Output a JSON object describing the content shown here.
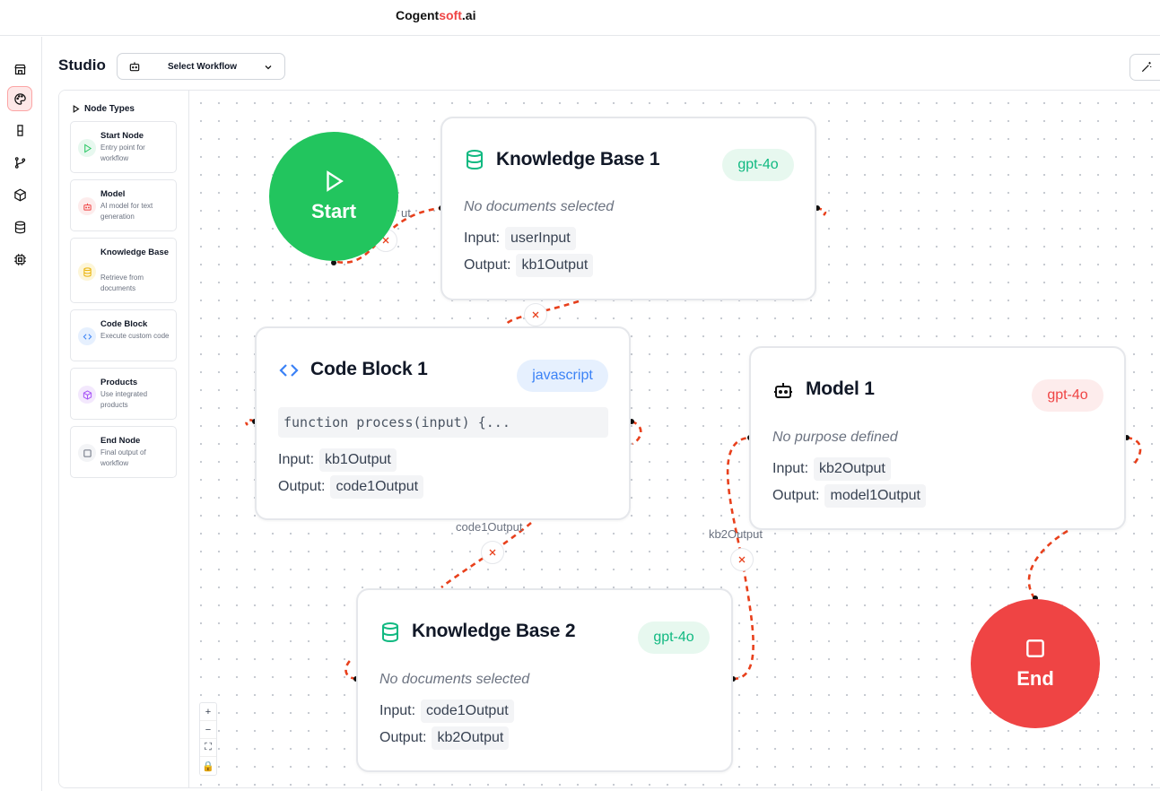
{
  "app": {
    "brand_main": "Cogent",
    "brand_accent": "soft",
    "brand_suffix": ".ai"
  },
  "rail": {
    "items": [
      "store-icon",
      "palette-icon",
      "flask-icon",
      "git-branch-icon",
      "package-icon",
      "database-icon",
      "cpu-icon"
    ]
  },
  "header": {
    "title": "Studio",
    "workflow_select": "Select Workflow"
  },
  "palette": {
    "heading": "Node Types",
    "items": [
      {
        "title": "Start Node",
        "desc": "Entry point for workflow",
        "icon": "play-icon",
        "color": "#22c55e"
      },
      {
        "title": "Model",
        "desc": "AI model for text generation",
        "icon": "bot-icon",
        "color": "#ef4444"
      },
      {
        "title": "Knowledge Base",
        "desc": "Retrieve from documents",
        "icon": "database-icon",
        "color": "#eab308"
      },
      {
        "title": "Code Block",
        "desc": "Execute custom code",
        "icon": "code-icon",
        "color": "#3b82f6"
      },
      {
        "title": "Products",
        "desc": "Use integrated products",
        "icon": "box-icon",
        "color": "#a855f7"
      },
      {
        "title": "End Node",
        "desc": "Final output of workflow",
        "icon": "square-icon",
        "color": "#6b7280"
      }
    ]
  },
  "nodes": {
    "start": {
      "label": "Start",
      "color": "#22c55e"
    },
    "end": {
      "label": "End",
      "color": "#ef4444"
    },
    "kb1": {
      "title": "Knowledge Base 1",
      "badge": "gpt-4o",
      "desc": "No documents selected",
      "input_label": "Input:",
      "input": "userInput",
      "output_label": "Output:",
      "output": "kb1Output"
    },
    "code1": {
      "title": "Code Block 1",
      "badge": "javascript",
      "code": "function process(input) {...",
      "input_label": "Input:",
      "input": "kb1Output",
      "output_label": "Output:",
      "output": "code1Output"
    },
    "model1": {
      "title": "Model 1",
      "badge": "gpt-4o",
      "desc": "No purpose defined",
      "input_label": "Input:",
      "input": "kb2Output",
      "output_label": "Output:",
      "output": "model1Output"
    },
    "kb2": {
      "title": "Knowledge Base 2",
      "badge": "gpt-4o",
      "desc": "No documents selected",
      "input_label": "Input:",
      "input": "code1Output",
      "output_label": "Output:",
      "output": "kb2Output"
    }
  },
  "edges": {
    "label_start": "ut",
    "label_code1": "code1Output",
    "label_kb2": "kb2Output"
  },
  "controls": {
    "zoom_in": "+",
    "zoom_out": "−",
    "fit": "⛶",
    "lock": "🔒"
  },
  "colors": {
    "edge": "#e8401c",
    "kb": "#10b981",
    "code": "#3b82f6",
    "model": "#ef4444"
  }
}
